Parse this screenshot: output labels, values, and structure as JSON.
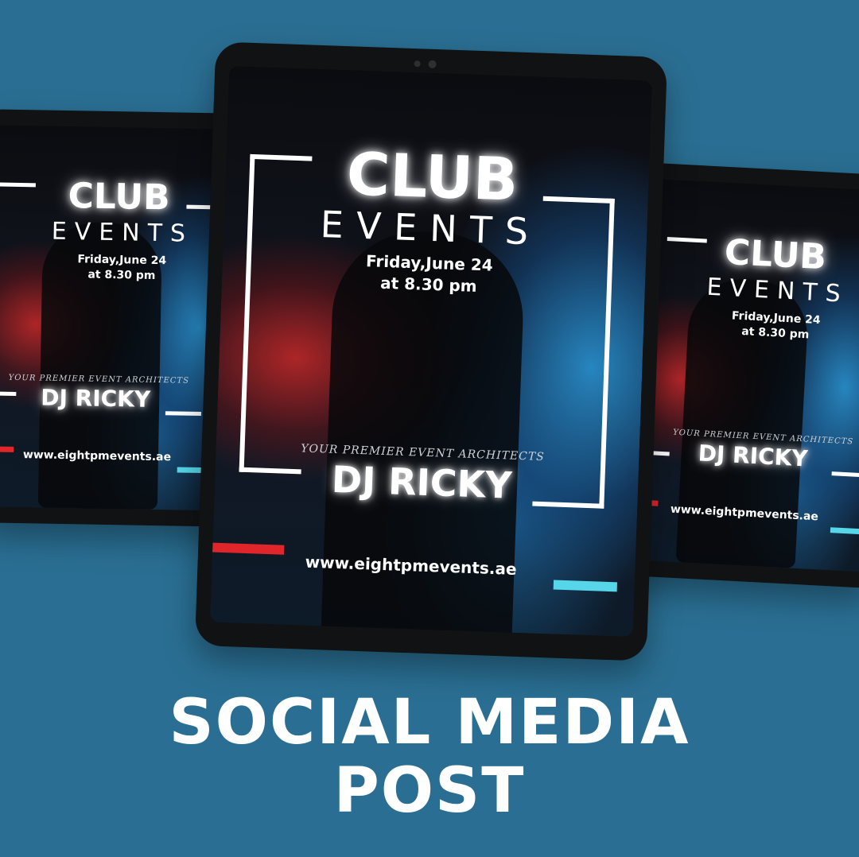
{
  "poster": {
    "club": "CLUB",
    "events": "EVENTS",
    "date_line1": "Friday,June 24",
    "date_line2": "at 8.30 pm",
    "tagline": "YOUR PREMIER EVENT ARCHITECTS",
    "dj": "DJ RICKY",
    "url": "www.eightpmevents.ae"
  },
  "headline": {
    "line1": "SOCIAL MEDIA",
    "line2": "POST"
  },
  "colors": {
    "background": "#2a6f93",
    "accent_red": "#e0262a",
    "accent_cyan": "#56d6e8"
  }
}
